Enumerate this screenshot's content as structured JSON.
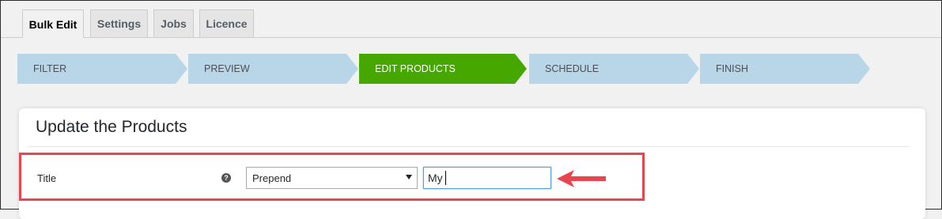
{
  "tabs": [
    {
      "label": "Bulk Edit"
    },
    {
      "label": "Settings"
    },
    {
      "label": "Jobs"
    },
    {
      "label": "Licence"
    }
  ],
  "steps": [
    {
      "label": "FILTER"
    },
    {
      "label": "PREVIEW"
    },
    {
      "label": "EDIT PRODUCTS"
    },
    {
      "label": "SCHEDULE"
    },
    {
      "label": "FINISH"
    }
  ],
  "card": {
    "title": "Update the Products",
    "row": {
      "label": "Title",
      "help_icon": "question-icon",
      "select_value": "Prepend",
      "input_value": "My"
    }
  },
  "colors": {
    "step": "#b9d6e8",
    "step_active": "#45a700",
    "highlight": "#e8454f"
  }
}
